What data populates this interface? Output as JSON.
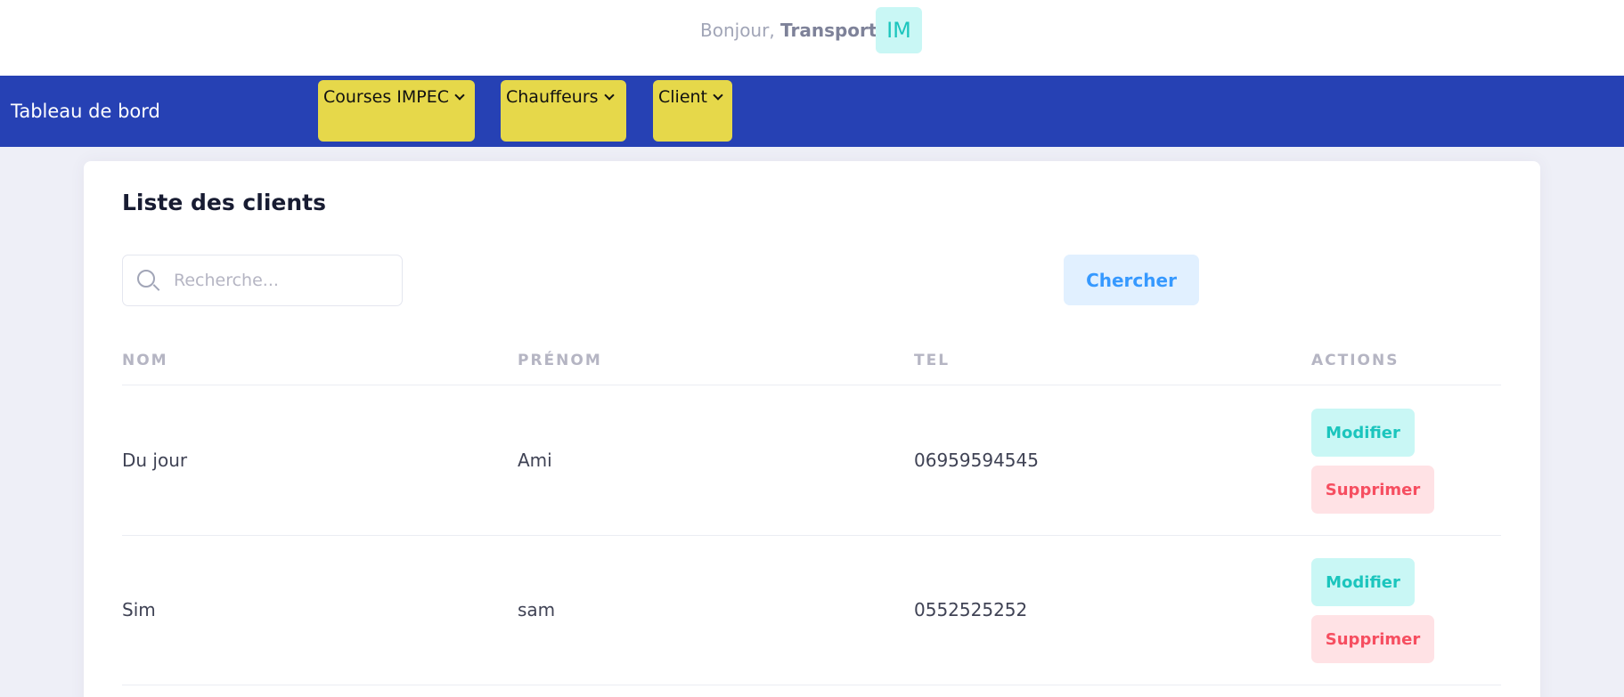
{
  "header": {
    "greeting_prefix": "Bonjour,",
    "greeting_name": "Transport",
    "avatar_initials": "IM"
  },
  "nav": {
    "brand": "Tableau de bord",
    "menus": [
      {
        "label": "Courses IMPEC",
        "icon": "chevron-down-icon"
      },
      {
        "label": "Chauffeurs",
        "icon": "chevron-down-icon"
      },
      {
        "label": "Client",
        "icon": "chevron-down-icon"
      }
    ]
  },
  "main": {
    "title": "Liste des clients",
    "search": {
      "placeholder": "Recherche...",
      "value": "",
      "icon": "search-icon"
    },
    "search_button": "Chercher",
    "table": {
      "headers": [
        "NOM",
        "PRÉNOM",
        "TEL",
        "ACTIONS"
      ],
      "rows": [
        {
          "nom": "Du jour",
          "prenom": "Ami",
          "tel": "06959594545",
          "edit": "Modifier",
          "delete": "Supprimer"
        },
        {
          "nom": "Sim",
          "prenom": "sam",
          "tel": "0552525252",
          "edit": "Modifier",
          "delete": "Supprimer"
        }
      ]
    }
  },
  "colors": {
    "navbar": "#2641b4",
    "menu_button": "#e6d84a",
    "primary_light": "#e1f0ff",
    "primary": "#3699ff",
    "success_light": "#c9f7f5",
    "success": "#1bc5bd",
    "danger_light": "#ffe2e5",
    "danger": "#f64e60"
  }
}
